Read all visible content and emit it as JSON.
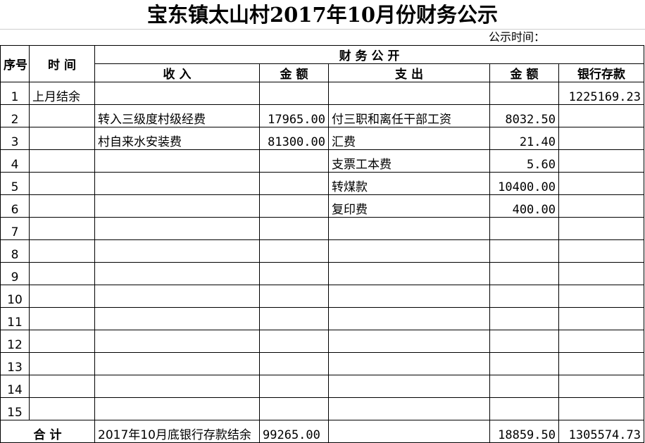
{
  "title": "宝东镇太山村2017年10月份财务公示",
  "publish_time_label": "公示时间：",
  "headers": {
    "seq": "序号",
    "time": "时  间",
    "group": "财    务    公    开",
    "income": "收        入",
    "income_amount": "金 额",
    "expense": "支           出",
    "expense_amount": "金 额",
    "bank_balance": "银行存款"
  },
  "rows": [
    {
      "seq": "1",
      "time": "上月结余",
      "income": "",
      "income_amount": "",
      "expense": "",
      "expense_amount": "",
      "bank": "1225169.23"
    },
    {
      "seq": "2",
      "time": "",
      "income": "转入三级度村级经费",
      "income_amount": "17965.00",
      "expense": "付三职和离任干部工资",
      "expense_amount": "8032.50",
      "bank": ""
    },
    {
      "seq": "3",
      "time": "",
      "income": "村自来水安装费",
      "income_amount": "81300.00",
      "expense": "汇费",
      "expense_amount": "21.40",
      "bank": ""
    },
    {
      "seq": "4",
      "time": "",
      "income": "",
      "income_amount": "",
      "expense": "支票工本费",
      "expense_amount": "5.60",
      "bank": ""
    },
    {
      "seq": "5",
      "time": "",
      "income": "",
      "income_amount": "",
      "expense": "转煤款",
      "expense_amount": "10400.00",
      "bank": ""
    },
    {
      "seq": "6",
      "time": "",
      "income": "",
      "income_amount": "",
      "expense": "复印费",
      "expense_amount": "400.00",
      "bank": ""
    },
    {
      "seq": "7",
      "time": "",
      "income": "",
      "income_amount": "",
      "expense": "",
      "expense_amount": "",
      "bank": ""
    },
    {
      "seq": "8",
      "time": "",
      "income": "",
      "income_amount": "",
      "expense": "",
      "expense_amount": "",
      "bank": ""
    },
    {
      "seq": "9",
      "time": "",
      "income": "",
      "income_amount": "",
      "expense": "",
      "expense_amount": "",
      "bank": ""
    },
    {
      "seq": "10",
      "time": "",
      "income": "",
      "income_amount": "",
      "expense": "",
      "expense_amount": "",
      "bank": ""
    },
    {
      "seq": "11",
      "time": "",
      "income": "",
      "income_amount": "",
      "expense": "",
      "expense_amount": "",
      "bank": ""
    },
    {
      "seq": "12",
      "time": "",
      "income": "",
      "income_amount": "",
      "expense": "",
      "expense_amount": "",
      "bank": ""
    },
    {
      "seq": "13",
      "time": "",
      "income": "",
      "income_amount": "",
      "expense": "",
      "expense_amount": "",
      "bank": ""
    },
    {
      "seq": "14",
      "time": "",
      "income": "",
      "income_amount": "",
      "expense": "",
      "expense_amount": "",
      "bank": ""
    },
    {
      "seq": "15",
      "time": "",
      "income": "",
      "income_amount": "",
      "expense": "",
      "expense_amount": "",
      "bank": ""
    }
  ],
  "total": {
    "label": "合        计",
    "income_note": "2017年10月底银行存款结余",
    "income_amount": "99265.00",
    "expense": "",
    "expense_amount": "18859.50",
    "bank": "1305574.73"
  }
}
